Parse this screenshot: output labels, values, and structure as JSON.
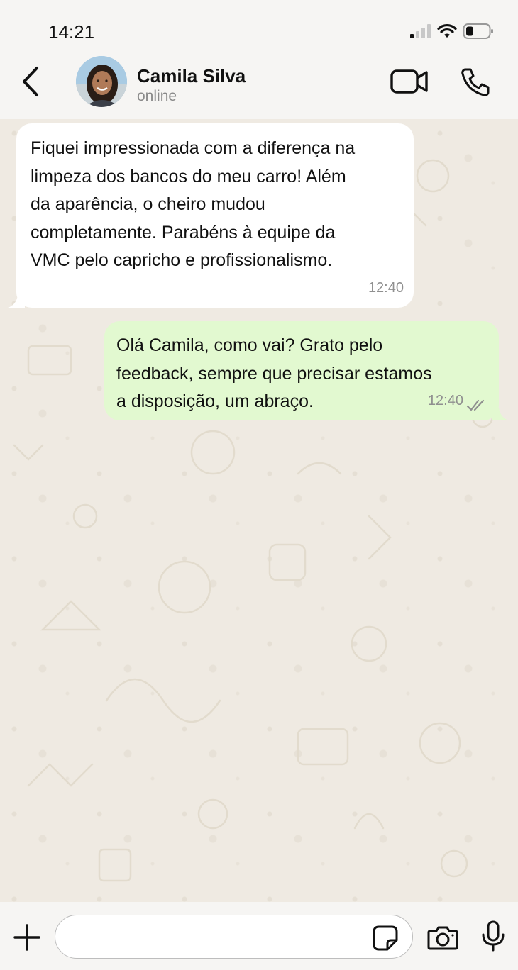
{
  "status_bar": {
    "time": "14:21"
  },
  "header": {
    "contact_name": "Camila Silva",
    "contact_status": "online"
  },
  "messages": [
    {
      "direction": "incoming",
      "text": "Fiquei impressionada com a diferença na\nlimpeza dos bancos do meu carro! Além\nda aparência, o cheiro mudou\ncompletamente. Parabéns à equipe da\nVMC pelo capricho e profissionalismo.",
      "time": "12:40"
    },
    {
      "direction": "outgoing",
      "text": "Olá Camila, como vai? Grato pelo\nfeedback, sempre que precisar estamos\na disposição, um abraço.",
      "time": "12:40",
      "status": "read-double-check-icon"
    }
  ],
  "composer": {
    "placeholder": "",
    "value": ""
  },
  "colors": {
    "incoming_bubble": "#ffffff",
    "outgoing_bubble": "#e2f9d0",
    "chat_background": "#efeae2",
    "bar_background": "#f6f5f3"
  }
}
